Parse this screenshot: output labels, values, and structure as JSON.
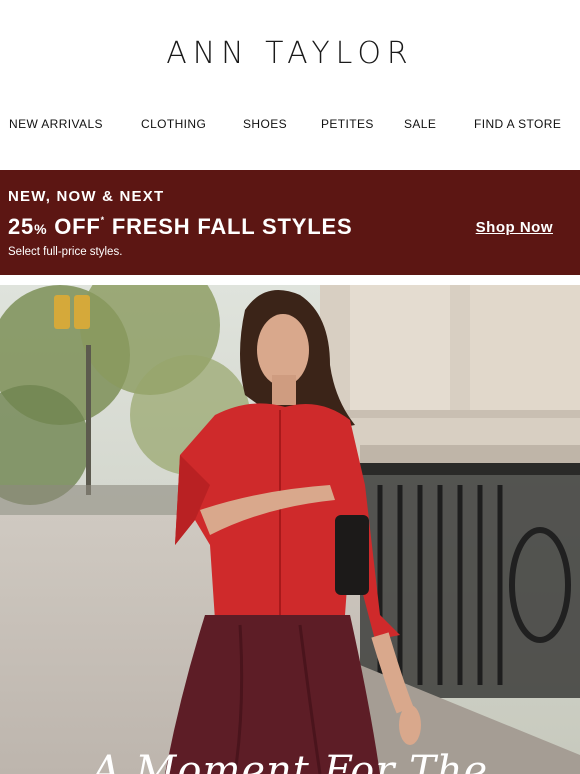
{
  "brand": {
    "logo_text": "ANN TAYLOR"
  },
  "nav": {
    "items": [
      {
        "label": "NEW ARRIVALS"
      },
      {
        "label": "CLOTHING"
      },
      {
        "label": "SHOES"
      },
      {
        "label": "PETITES"
      },
      {
        "label": "SALE"
      },
      {
        "label": "FIND A STORE"
      }
    ]
  },
  "promo": {
    "eyebrow": "NEW, NOW & NEXT",
    "discount_number": "25",
    "discount_unit": "%",
    "discount_word": "OFF",
    "asterisk": "*",
    "headline_rest": "FRESH FALL STYLES",
    "subtext": "Select full-price styles.",
    "cta_label": "Shop Now",
    "background_color": "#5c1613"
  },
  "hero": {
    "title": "A Moment For The"
  }
}
